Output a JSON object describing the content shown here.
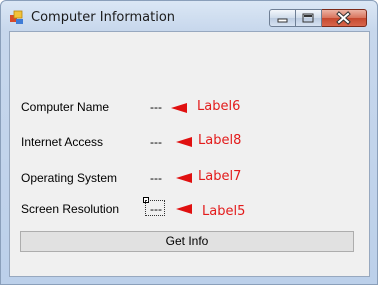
{
  "window": {
    "title": "Computer Information",
    "icon": "forms-app-icon",
    "controls": [
      "minimize-icon",
      "maximize-icon",
      "close-icon"
    ]
  },
  "fields": [
    {
      "label": "Computer Name",
      "value": "---",
      "annotation": "Label6"
    },
    {
      "label": "Internet Access",
      "value": "---",
      "annotation": "Label8"
    },
    {
      "label": "Operating System",
      "value": "---",
      "annotation": "Label7"
    },
    {
      "label": "Screen Resolution",
      "value": "---",
      "annotation": "Label5"
    }
  ],
  "button": {
    "label": "Get Info"
  },
  "colors": {
    "annotation": "#e31b1b",
    "arrow": "#e01010",
    "form_bg": "#f0f0f0"
  }
}
